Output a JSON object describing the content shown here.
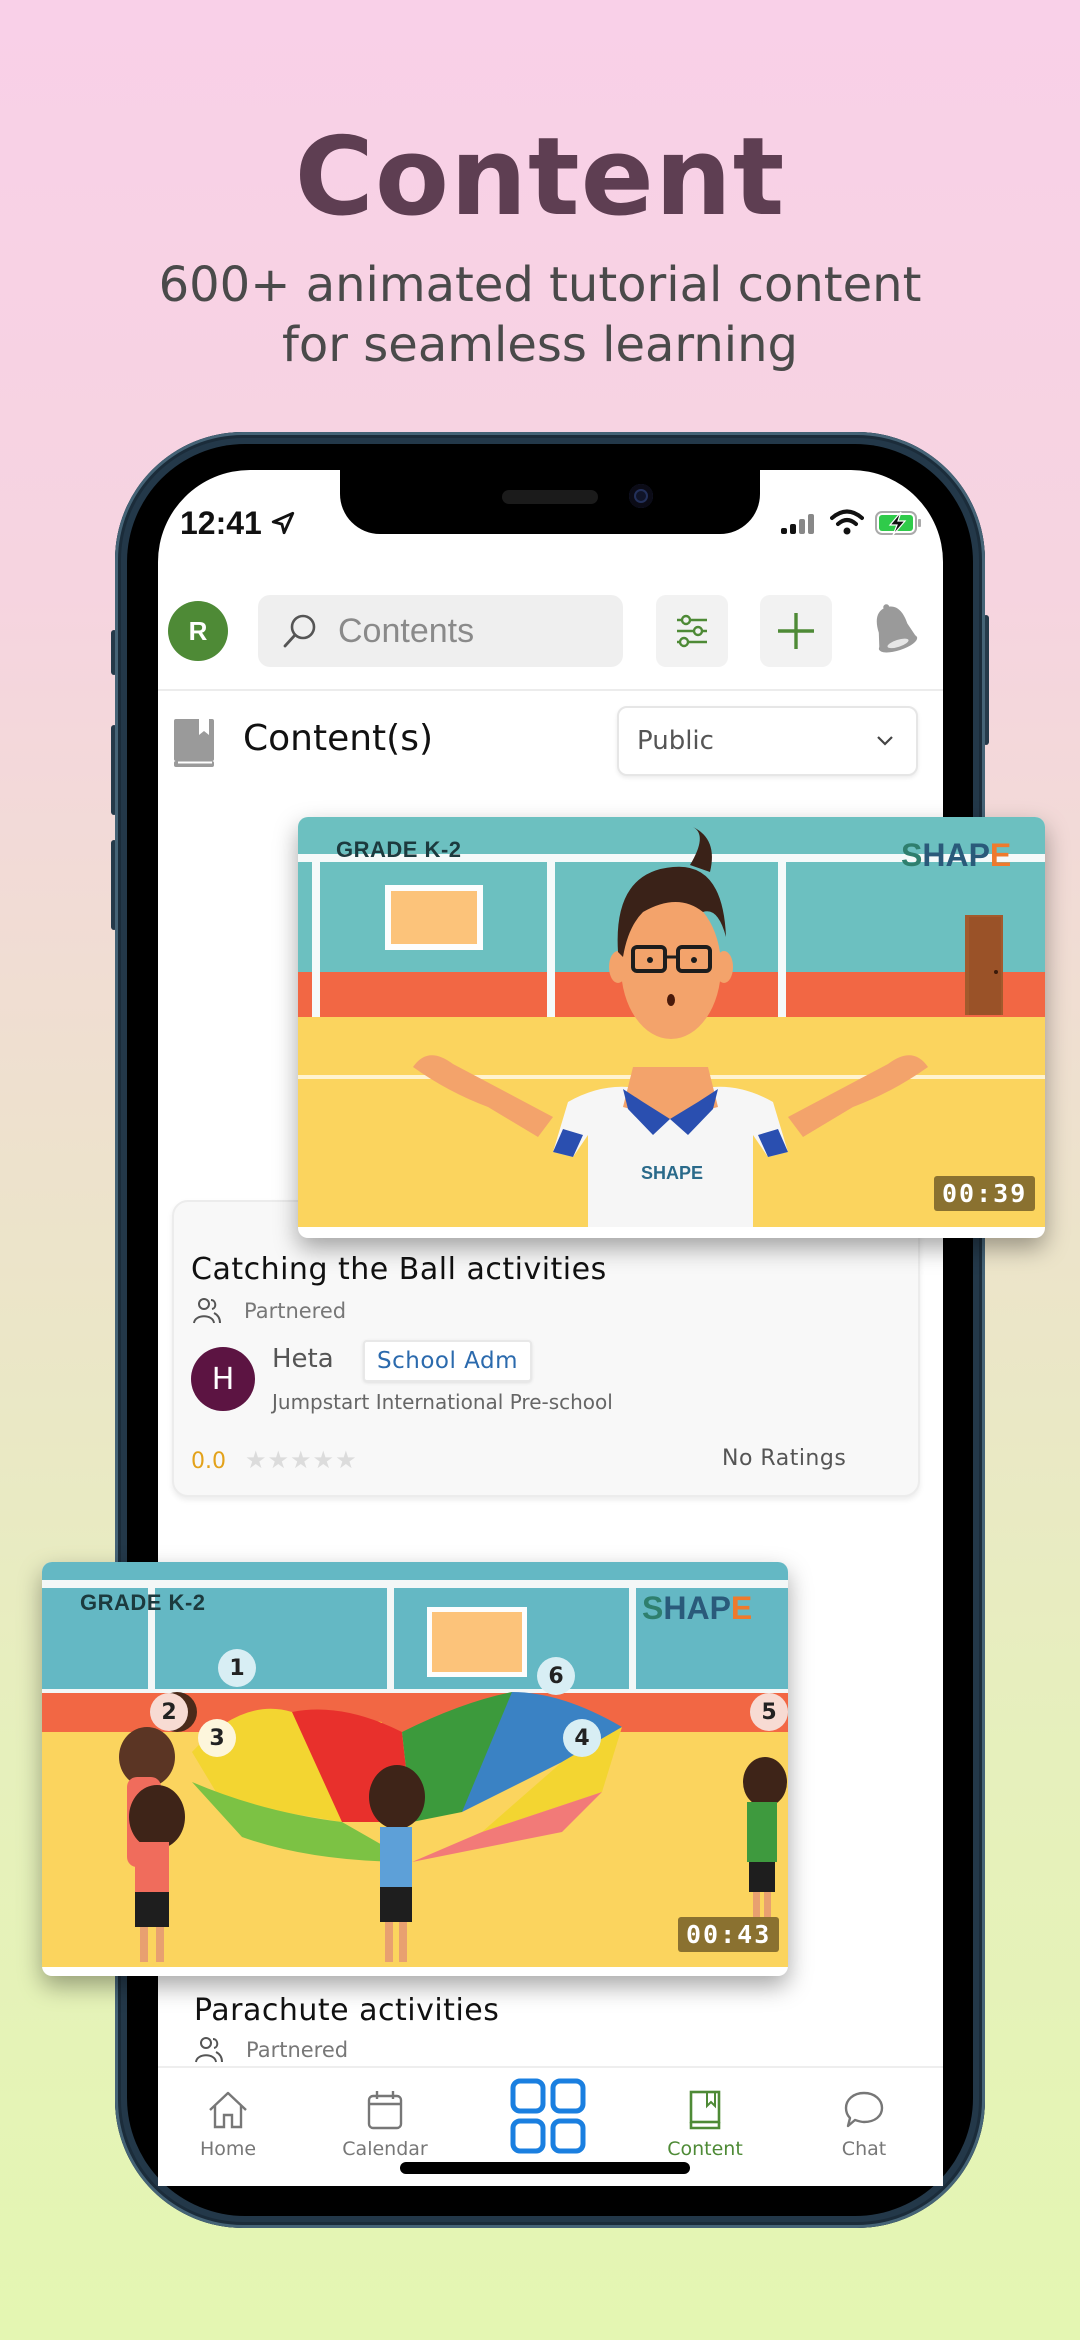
{
  "promo": {
    "title": "Content",
    "subtitle_line1": "600+ animated tutorial content",
    "subtitle_line2": "for seamless learning"
  },
  "status_bar": {
    "time": "12:41",
    "icons": [
      "location-arrow-icon",
      "signal-icon",
      "wifi-icon",
      "battery-charging-icon"
    ]
  },
  "header": {
    "avatar_initial": "R",
    "search_placeholder": "Contents",
    "buttons": [
      "filter-icon",
      "plus-icon",
      "bell-icon"
    ]
  },
  "section": {
    "title": "Content(s)",
    "visibility_selected": "Public"
  },
  "contents": [
    {
      "grade": "GRADE K-2",
      "logo": "SHAPE",
      "duration": "00:39",
      "title": "Catching the Ball activities",
      "share_type": "Partnered",
      "author_initial": "H",
      "author_name": "Heta",
      "author_role": "School Adm",
      "school": "Jumpstart International Pre-school",
      "rating": "0.0",
      "stars_filled": 0,
      "stars_total": 5,
      "ratings_label": "No Ratings"
    },
    {
      "grade": "GRADE K-2",
      "logo": "SHAPE",
      "duration": "00:43",
      "title": "Parachute activities",
      "share_type": "Partnered",
      "markers": [
        "1",
        "2",
        "3",
        "4",
        "5",
        "6"
      ]
    }
  ],
  "tabbar": {
    "tabs": [
      {
        "label": "Home",
        "icon": "home-icon",
        "active": false
      },
      {
        "label": "Calendar",
        "icon": "calendar-icon",
        "active": false
      },
      {
        "label": "",
        "icon": "grid-apps-icon",
        "active": false
      },
      {
        "label": "Content",
        "icon": "book-icon",
        "active": true
      },
      {
        "label": "Chat",
        "icon": "chat-bubble-icon",
        "active": false
      }
    ]
  },
  "colors": {
    "title": "#5e3e52",
    "brand_green": "#4e8a36",
    "badge_blue": "#2b6aad",
    "grid_blue": "#1a7fe0",
    "rating_orange": "#e3a21a",
    "author_avatar": "#5c1442"
  }
}
